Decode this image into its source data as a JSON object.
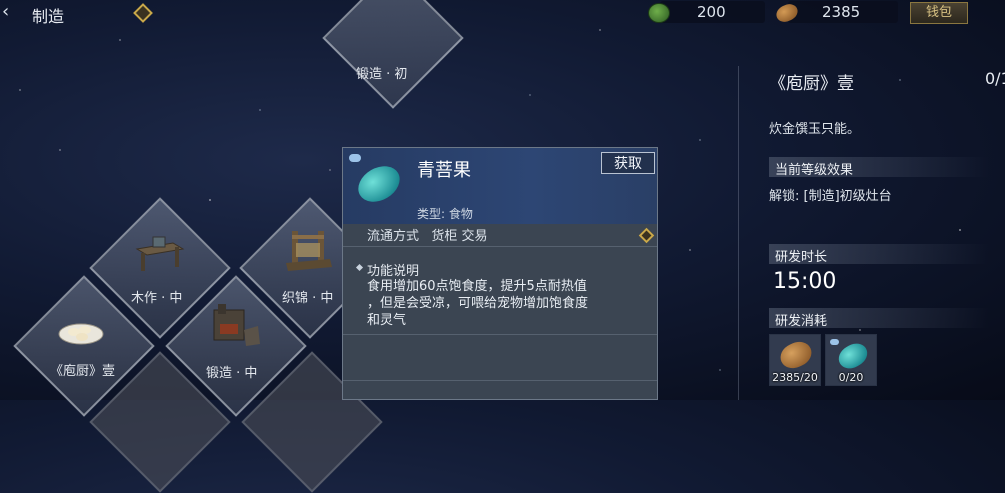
{
  "topbar": {
    "back_glyph": "‹",
    "title": "制造",
    "currency_green": "200",
    "currency_bean": "2385",
    "wallet_label": "钱包"
  },
  "craft_tiles": [
    {
      "label": "锻造 · 初"
    },
    {
      "label": "木作 · 中"
    },
    {
      "label": "织锦 · 中"
    },
    {
      "label": "《庖厨》壹"
    },
    {
      "label": "锻造 · 中"
    }
  ],
  "popup": {
    "name": "青菩果",
    "type": "类型: 食物",
    "get_label": "获取",
    "circulation": "流通方式   货柜 交易",
    "function_title": "功能说明",
    "function_text": "食用增加60点饱食度，提升5点耐热值\n，但是会受凉，可喂给宠物增加饱食度\n和灵气"
  },
  "right_panel": {
    "title": "《庖厨》壹",
    "count": "0/1",
    "desc": "炊金馔玉只能。",
    "effect_header": "当前等级效果",
    "unlock_text": "解锁: [制造]初级灶台",
    "duration_header": "研发时长",
    "duration_value": "15:00",
    "cost_header": "研发消耗",
    "costs": [
      {
        "label": "2385/20",
        "icon": "bean-icon"
      },
      {
        "label": "0/20",
        "icon": "jade-fruit-icon"
      }
    ]
  }
}
